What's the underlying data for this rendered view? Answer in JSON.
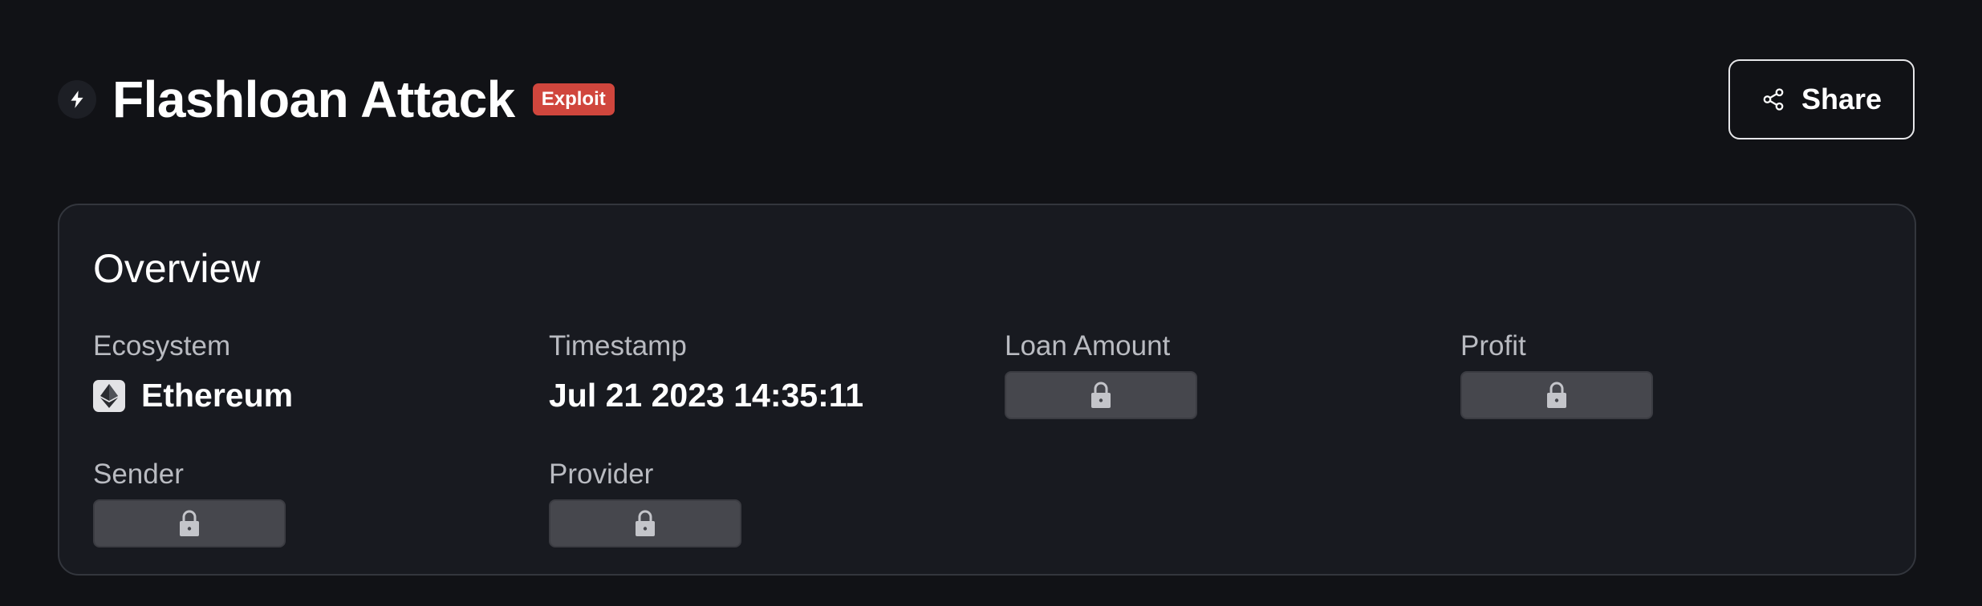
{
  "header": {
    "title": "Flashloan Attack",
    "badge": "Exploit",
    "share_label": "Share"
  },
  "overview": {
    "title": "Overview",
    "fields": [
      {
        "label": "Ecosystem",
        "value": "Ethereum",
        "icon": "ethereum-icon",
        "locked": false
      },
      {
        "label": "Timestamp",
        "value": "Jul 21 2023 14:35:11",
        "locked": false
      },
      {
        "label": "Loan Amount",
        "value": null,
        "icon": "lock-icon",
        "locked": true
      },
      {
        "label": "Profit",
        "value": null,
        "icon": "lock-icon",
        "locked": true
      },
      {
        "label": "Sender",
        "value": null,
        "icon": "lock-icon",
        "locked": true
      },
      {
        "label": "Provider",
        "value": null,
        "icon": "lock-icon",
        "locked": true
      }
    ]
  },
  "colors": {
    "background": "#111216",
    "card": "#181a20",
    "badge": "#d0463d",
    "locked_placeholder": "#46474d"
  }
}
